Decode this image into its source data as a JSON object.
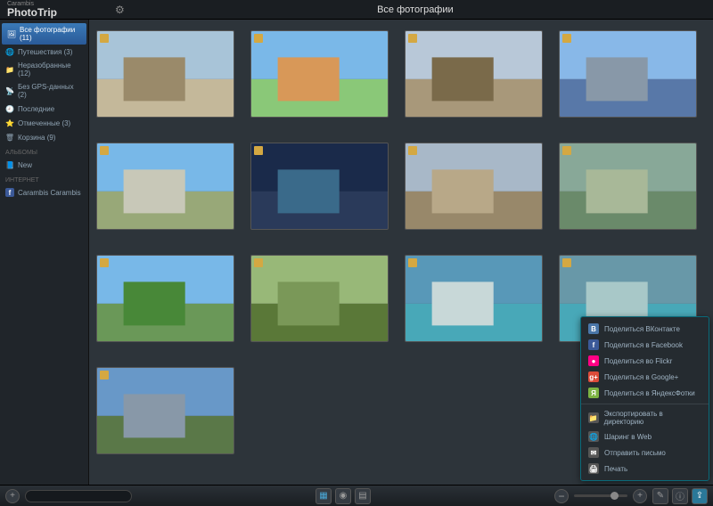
{
  "header": {
    "brand_sub": "Carambis",
    "brand_main": "PhotoTrip",
    "title": "Все фотографии"
  },
  "sidebar": {
    "items": [
      {
        "icon": "🖼",
        "label": "Все фотографии (11)",
        "active": true
      },
      {
        "icon": "🌐",
        "label": "Путешествия (3)"
      },
      {
        "icon": "📁",
        "label": "Неразобранные (12)"
      },
      {
        "icon": "📡",
        "label": "Без GPS-данных (2)"
      },
      {
        "icon": "🕘",
        "label": "Последние"
      },
      {
        "icon": "⭐",
        "label": "Отмеченные (3)"
      },
      {
        "icon": "🗑",
        "label": "Корзина (9)"
      }
    ],
    "section_albums": "АЛЬБОМЫ",
    "albums": [
      {
        "icon": "📘",
        "label": "New"
      }
    ],
    "section_internet": "ИНТЕРНЕТ",
    "internet": [
      {
        "icon": "f",
        "label": "Carambis Carambis"
      }
    ]
  },
  "share_menu": {
    "items": [
      {
        "cls": "vk",
        "icon": "В",
        "label": "Поделиться ВКонтакте"
      },
      {
        "cls": "fb",
        "icon": "f",
        "label": "Поделиться в Facebook"
      },
      {
        "cls": "fl",
        "icon": "●",
        "label": "Поделиться во Flickr"
      },
      {
        "cls": "gp",
        "icon": "g+",
        "label": "Поделиться в Google+"
      },
      {
        "cls": "ya",
        "icon": "Я",
        "label": "Поделиться в ЯндексФотки"
      },
      {
        "sep": true
      },
      {
        "cls": "ex",
        "icon": "📁",
        "label": "Экспортировать в директорию"
      },
      {
        "cls": "wb",
        "icon": "🌐",
        "label": "Шаринг в Web"
      },
      {
        "cls": "ml",
        "icon": "✉",
        "label": "Отправить письмо"
      },
      {
        "cls": "pr",
        "icon": "🖨",
        "label": "Печать"
      }
    ]
  },
  "thumbs": [
    {
      "sky": "#a8c4d8",
      "bg": "#c4b89a",
      "fg": "#9a8a6a"
    },
    {
      "sky": "#7ab8e8",
      "bg": "#8ac878",
      "fg": "#d89858"
    },
    {
      "sky": "#b8c8d8",
      "bg": "#a8987a",
      "fg": "#7a6a4a"
    },
    {
      "sky": "#88b8e8",
      "bg": "#5878a8",
      "fg": "#8898a8"
    },
    {
      "sky": "#78b8e8",
      "bg": "#98a878",
      "fg": "#c8c8b8"
    },
    {
      "sky": "#1a2a4a",
      "bg": "#2a3a5a",
      "fg": "#3a6a8a"
    },
    {
      "sky": "#a8b8c8",
      "bg": "#98886a",
      "fg": "#b8a888"
    },
    {
      "sky": "#88a898",
      "bg": "#6a8a6a",
      "fg": "#a8b898"
    },
    {
      "sky": "#78b8e8",
      "bg": "#6a9858",
      "fg": "#488838"
    },
    {
      "sky": "#98b878",
      "bg": "#5a7838",
      "fg": "#7a9858"
    },
    {
      "sky": "#5898b8",
      "bg": "#48a8b8",
      "fg": "#c8d8d8"
    },
    {
      "sky": "#6898a8",
      "bg": "#48a8b8",
      "fg": "#a8c8c8"
    },
    {
      "sky": "#6898c8",
      "bg": "#5a7848",
      "fg": "#8898a8"
    }
  ]
}
